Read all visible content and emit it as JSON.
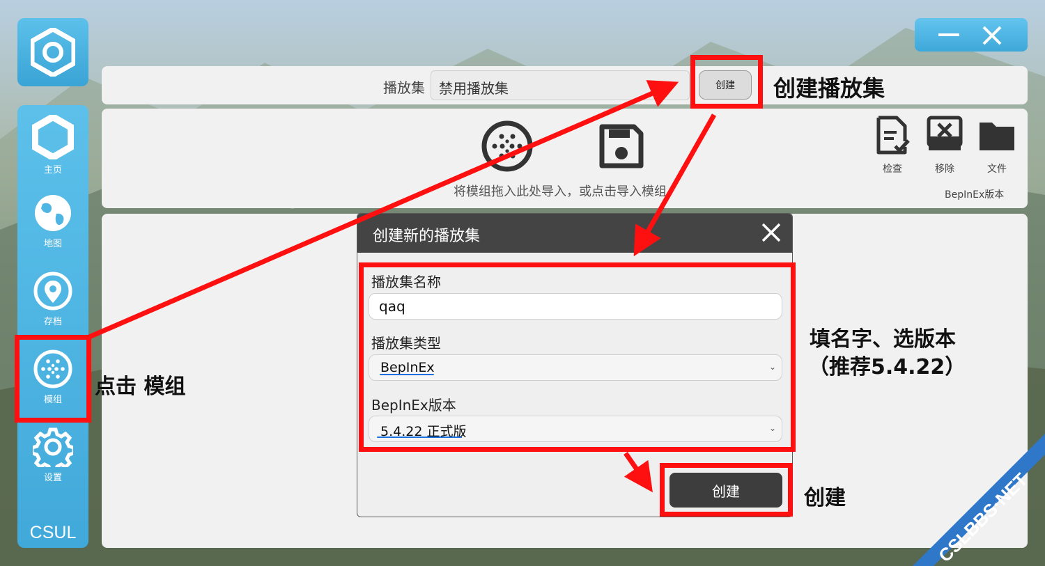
{
  "sidebar": {
    "items": [
      {
        "label": "主页",
        "icon": "home-hexagon-icon"
      },
      {
        "label": "地图",
        "icon": "globe-icon"
      },
      {
        "label": "存档",
        "icon": "location-pin-icon"
      },
      {
        "label": "模组",
        "icon": "mods-dots-icon"
      },
      {
        "label": "设置",
        "icon": "gear-icon"
      }
    ],
    "brand": "CSUL"
  },
  "topbar": {
    "playset_label": "播放集",
    "playset_value": "禁用播放集",
    "create_label": "创建"
  },
  "import_panel": {
    "hint": "将模组拖入此处导入，或点击导入模组",
    "tools": [
      {
        "label": "检查",
        "icon": "document-check-icon"
      },
      {
        "label": "移除",
        "icon": "remove-box-icon"
      },
      {
        "label": "文件",
        "icon": "folder-icon"
      }
    ],
    "bepinex_version_label": "BepInEx版本"
  },
  "dialog": {
    "title": "创建新的播放集",
    "name_label": "播放集名称",
    "name_value": "qaq",
    "type_label": "播放集类型",
    "type_value": "BepInEx",
    "version_label": "BepInEx版本",
    "version_value": "5.4.22 正式版",
    "create_label": "创建"
  },
  "annotations": {
    "create_playset": "创建播放集",
    "click_mods": "点击 模组",
    "fill_line1": "填名字、选版本",
    "fill_line2": "（推荐5.4.22）",
    "create": "创建"
  },
  "watermark": "CSLBBS·NET",
  "colors": {
    "sidebar": "#4fb5e3",
    "highlight": "#ff1010",
    "dialog_header": "#444444"
  }
}
